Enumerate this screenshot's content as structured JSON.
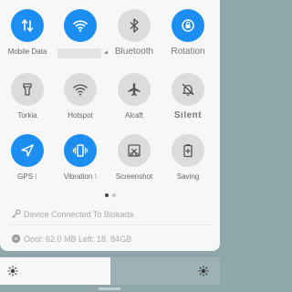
{
  "quick_settings": {
    "row1": [
      {
        "label": "Mobile Data",
        "icon": "mobile-data-icon",
        "state": "on"
      },
      {
        "label": "",
        "icon": "wifi-icon",
        "state": "on"
      },
      {
        "label": "Bluetooth",
        "icon": "bluetooth-icon",
        "state": "off"
      },
      {
        "label": "Rotation",
        "icon": "rotation-lock-icon",
        "state": "on"
      }
    ],
    "row2": [
      {
        "label": "Torkia",
        "icon": "flashlight-icon",
        "state": "off"
      },
      {
        "label": "Hotspot",
        "icon": "hotspot-icon",
        "state": "off"
      },
      {
        "label": "Alcaft",
        "icon": "airplane-icon",
        "state": "off"
      },
      {
        "label": "Silent",
        "icon": "silent-bell-icon",
        "state": "off"
      }
    ],
    "row3": [
      {
        "label": "GPS",
        "icon": "location-icon",
        "state": "on"
      },
      {
        "label": "Vibration",
        "icon": "vibration-icon",
        "state": "on"
      },
      {
        "label": "Screenshot",
        "icon": "screenshot-icon",
        "state": "off"
      },
      {
        "label": "Saving",
        "icon": "battery-saver-icon",
        "state": "off"
      }
    ]
  },
  "pager": {
    "pages": 2,
    "current": 1
  },
  "vpn_status": "Device Connected To Blokada",
  "data_usage": "Oool: 62.0 MB Left: 18. 84GB",
  "colors": {
    "accent": "#1c8ef2",
    "tile_off": "#dcdcdc",
    "panel": "#f7f7f7"
  }
}
